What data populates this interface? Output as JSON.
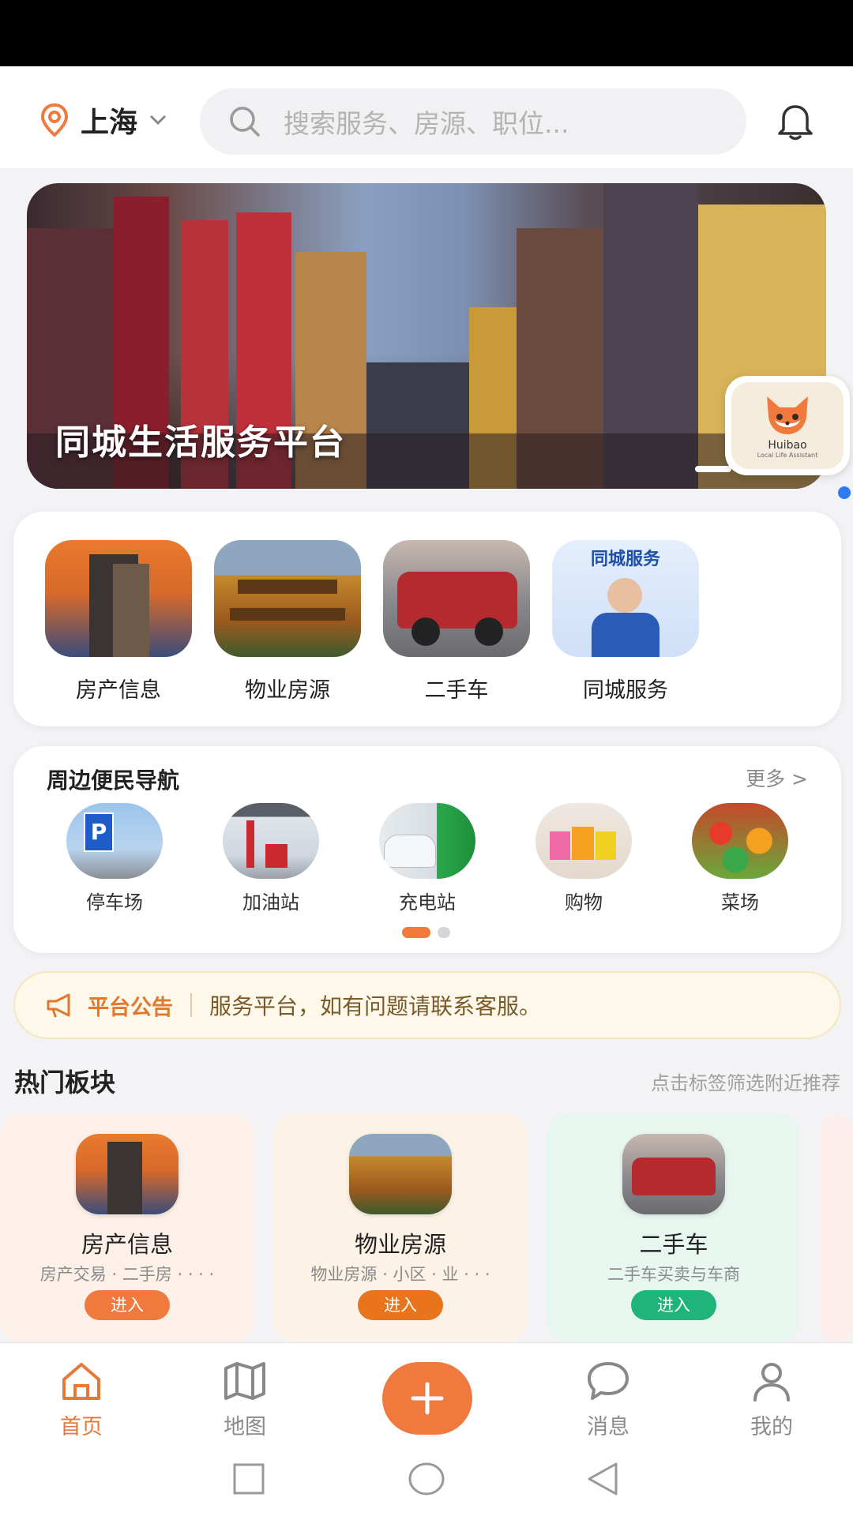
{
  "header": {
    "city": "上海",
    "search_placeholder": "搜索服务、房源、职位..."
  },
  "banner": {
    "title": "同城生活服务平台",
    "mascot_name": "Huibao",
    "mascot_sub": "Local Life Assistant"
  },
  "main_categories": [
    {
      "label": "房产信息",
      "icon": "building-photo"
    },
    {
      "label": "物业房源",
      "icon": "temple-photo"
    },
    {
      "label": "二手车",
      "icon": "suv-photo"
    },
    {
      "label": "同城服务",
      "icon": "service-worker-photo",
      "overlay": "同城服务"
    }
  ],
  "nearby": {
    "title": "周边便民导航",
    "more": "更多 >",
    "items": [
      {
        "label": "停车场",
        "icon": "parking-photo"
      },
      {
        "label": "加油站",
        "icon": "gas-station-photo"
      },
      {
        "label": "充电站",
        "icon": "charging-station-photo"
      },
      {
        "label": "购物",
        "icon": "shopping-photo"
      },
      {
        "label": "菜场",
        "icon": "vegetables-photo"
      }
    ]
  },
  "notice": {
    "tag": "平台公告",
    "text": "服务平台，如有问题请联系客服。"
  },
  "hot": {
    "title": "热门板块",
    "hint": "点击标签筛选附近推荐",
    "cards": [
      {
        "name": "房产信息",
        "desc": "房产交易 · 二手房 · · · ·",
        "button": "进入",
        "bg": "#fdf0e8",
        "btn_color": "#f07a3e"
      },
      {
        "name": "物业房源",
        "desc": "物业房源 · 小区 · 业 · · ·",
        "button": "进入",
        "bg": "#fdf2e6",
        "btn_color": "#e8741c"
      },
      {
        "name": "二手车",
        "desc": "二手车买卖与车商",
        "button": "进入",
        "bg": "#e7f7ef",
        "btn_color": "#1fb57a"
      }
    ]
  },
  "tabbar": {
    "items": [
      {
        "label": "首页",
        "icon": "home-icon",
        "active": true
      },
      {
        "label": "地图",
        "icon": "map-icon"
      },
      {
        "label": "",
        "icon": "plus-icon"
      },
      {
        "label": "消息",
        "icon": "message-icon"
      },
      {
        "label": "我的",
        "icon": "user-icon"
      }
    ]
  },
  "colors": {
    "accent": "#f07a3e",
    "green": "#1fb57a",
    "notice_bg": "#fdf8ea"
  }
}
